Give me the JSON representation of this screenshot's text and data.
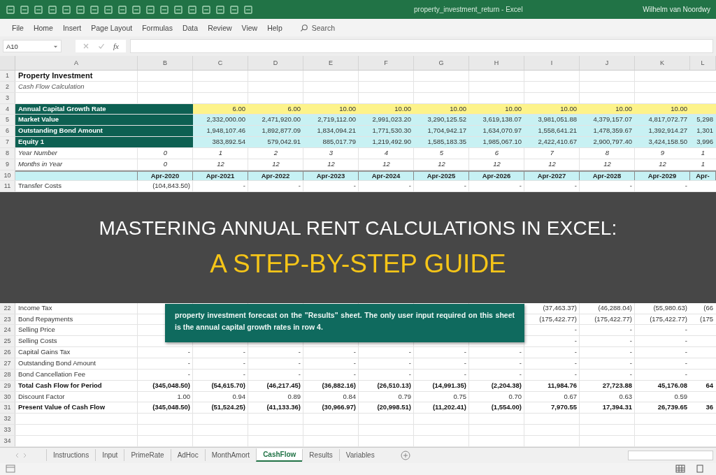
{
  "window": {
    "title": "property_investment_return - Excel",
    "user": "Wilhelm van Noordwy"
  },
  "menu": [
    {
      "label": "File"
    },
    {
      "label": "Home"
    },
    {
      "label": "Insert"
    },
    {
      "label": "Page Layout"
    },
    {
      "label": "Formulas"
    },
    {
      "label": "Data"
    },
    {
      "label": "Review"
    },
    {
      "label": "View"
    },
    {
      "label": "Help"
    }
  ],
  "search": {
    "placeholder": "Search"
  },
  "name_box": {
    "value": "A10"
  },
  "formula_bar": {
    "fx": "fx"
  },
  "columns": [
    "A",
    "B",
    "C",
    "D",
    "E",
    "F",
    "G",
    "H",
    "I",
    "J",
    "K",
    "L"
  ],
  "rows_above": [
    {
      "num": "1",
      "kind": "title",
      "cells": {
        "A": "Property Investment"
      }
    },
    {
      "num": "2",
      "kind": "subtitle",
      "cells": {
        "A": "Cash Flow Calculation"
      }
    },
    {
      "num": "3",
      "kind": "line"
    },
    {
      "num": "4",
      "kind": "input",
      "cells": {
        "A": "Annual Capital Growth Rate",
        "C": "6.00",
        "D": "6.00",
        "E": "10.00",
        "F": "10.00",
        "G": "10.00",
        "H": "10.00",
        "I": "10.00",
        "J": "10.00",
        "K": "10.00"
      }
    },
    {
      "num": "5",
      "kind": "output",
      "cells": {
        "A": "Market Value",
        "C": "2,332,000.00",
        "D": "2,471,920.00",
        "E": "2,719,112.00",
        "F": "2,991,023.20",
        "G": "3,290,125.52",
        "H": "3,619,138.07",
        "I": "3,981,051.88",
        "J": "4,379,157.07",
        "K": "4,817,072.77",
        "L": "5,298"
      }
    },
    {
      "num": "6",
      "kind": "output",
      "cells": {
        "A": "Outstanding Bond Amount",
        "C": "1,948,107.46",
        "D": "1,892,877.09",
        "E": "1,834,094.21",
        "F": "1,771,530.30",
        "G": "1,704,942.17",
        "H": "1,634,070.97",
        "I": "1,558,641.21",
        "J": "1,478,359.67",
        "K": "1,392,914.27",
        "L": "1,301"
      }
    },
    {
      "num": "7",
      "kind": "output",
      "cells": {
        "A": "Equity 1",
        "C": "383,892.54",
        "D": "579,042.91",
        "E": "885,017.79",
        "F": "1,219,492.90",
        "G": "1,585,183.35",
        "H": "1,985,067.10",
        "I": "2,422,410.67",
        "J": "2,900,797.40",
        "K": "3,424,158.50",
        "L": "3,996"
      }
    },
    {
      "num": "8",
      "kind": "count",
      "cells": {
        "A": "Year Number",
        "B": "0",
        "C": "1",
        "D": "2",
        "E": "3",
        "F": "4",
        "G": "5",
        "H": "6",
        "I": "7",
        "J": "8",
        "K": "9",
        "L": "1"
      }
    },
    {
      "num": "9",
      "kind": "count",
      "cells": {
        "A": "Months in Year",
        "B": "0",
        "C": "12",
        "D": "12",
        "E": "12",
        "F": "12",
        "G": "12",
        "H": "12",
        "I": "12",
        "J": "12",
        "K": "12",
        "L": "1"
      }
    },
    {
      "num": "10",
      "kind": "header",
      "cells": {
        "B": "Apr-2020",
        "C": "Apr-2021",
        "D": "Apr-2022",
        "E": "Apr-2023",
        "F": "Apr-2024",
        "G": "Apr-2025",
        "H": "Apr-2026",
        "I": "Apr-2027",
        "J": "Apr-2028",
        "K": "Apr-2029",
        "L": "Apr-"
      }
    },
    {
      "num": "11",
      "kind": "line",
      "cells": {
        "A": "Transfer Costs",
        "B": "(104,843.50)",
        "C": "-",
        "D": "-",
        "E": "-",
        "F": "-",
        "G": "-",
        "H": "-",
        "I": "-",
        "J": "-",
        "K": "-"
      }
    }
  ],
  "banner": {
    "title": "MASTERING ANNUAL RENT CALCULATIONS IN EXCEL:",
    "subtitle": "A STEP-BY-STEP GUIDE"
  },
  "rows_below": [
    {
      "num": "22",
      "kind": "line",
      "cells": {
        "A": "Income Tax",
        "I": "(37,463.37)",
        "J": "(46,288.04)",
        "K": "(55,980.63)",
        "L": "(66"
      }
    },
    {
      "num": "23",
      "kind": "line",
      "cells": {
        "A": "Bond Repayments",
        "I": "(175,422.77)",
        "J": "(175,422.77)",
        "K": "(175,422.77)",
        "L": "(175"
      }
    },
    {
      "num": "24",
      "kind": "line",
      "cells": {
        "A": "Selling Price",
        "I": "-",
        "J": "-",
        "K": "-"
      }
    },
    {
      "num": "25",
      "kind": "line",
      "cells": {
        "A": "Selling Costs",
        "I": "-",
        "J": "-",
        "K": "-"
      }
    },
    {
      "num": "26",
      "kind": "line",
      "cells": {
        "A": "Capital Gains Tax",
        "B": "-",
        "C": "-",
        "D": "-",
        "E": "-",
        "F": "-",
        "G": "-",
        "H": "-",
        "I": "-",
        "J": "-",
        "K": "-"
      }
    },
    {
      "num": "27",
      "kind": "line",
      "cells": {
        "A": "Outstanding Bond Amount",
        "B": "-",
        "C": "-",
        "D": "-",
        "E": "-",
        "F": "-",
        "G": "-",
        "H": "-",
        "I": "-",
        "J": "-",
        "K": "-"
      }
    },
    {
      "num": "28",
      "kind": "line",
      "cells": {
        "A": "Bond Cancellation Fee",
        "B": "-",
        "C": "-",
        "D": "-",
        "E": "-",
        "F": "-",
        "G": "-",
        "H": "-",
        "I": "-",
        "J": "-",
        "K": "-"
      }
    },
    {
      "num": "29",
      "kind": "total",
      "cells": {
        "A": "Total Cash Flow for Period",
        "B": "(345,048.50)",
        "C": "(54,615.70)",
        "D": "(46,217.45)",
        "E": "(36,882.16)",
        "F": "(26,510.13)",
        "G": "(14,991.35)",
        "H": "(2,204.38)",
        "I": "11,984.76",
        "J": "27,723.88",
        "K": "45,176.08",
        "L": "64"
      }
    },
    {
      "num": "30",
      "kind": "line",
      "cells": {
        "A": "Discount Factor",
        "B": "1.00",
        "C": "0.94",
        "D": "0.89",
        "E": "0.84",
        "F": "0.79",
        "G": "0.75",
        "H": "0.70",
        "I": "0.67",
        "J": "0.63",
        "K": "0.59"
      }
    },
    {
      "num": "31",
      "kind": "total",
      "cells": {
        "A": "Present Value of Cash Flow",
        "B": "(345,048.50)",
        "C": "(51,524.25)",
        "D": "(41,133.36)",
        "E": "(30,966.97)",
        "F": "(20,998.51)",
        "G": "(11,202.41)",
        "H": "(1,554.00)",
        "I": "7,970.55",
        "J": "17,394.31",
        "K": "26,739.65",
        "L": "36"
      }
    },
    {
      "num": "32",
      "kind": "line"
    },
    {
      "num": "33",
      "kind": "line"
    },
    {
      "num": "34",
      "kind": "line"
    }
  ],
  "note": {
    "text": "property investment forecast on the \"Results\" sheet. The only user input required on this sheet is the annual capital growth rates in row 4."
  },
  "sheet_tabs": [
    {
      "label": "Instructions",
      "selected": false
    },
    {
      "label": "Input",
      "selected": false
    },
    {
      "label": "PrimeRate",
      "selected": false
    },
    {
      "label": "AdHoc",
      "selected": false
    },
    {
      "label": "MonthAmort",
      "selected": false
    },
    {
      "label": "CashFlow",
      "selected": true
    },
    {
      "label": "Results",
      "selected": false
    },
    {
      "label": "Variables",
      "selected": false
    }
  ]
}
